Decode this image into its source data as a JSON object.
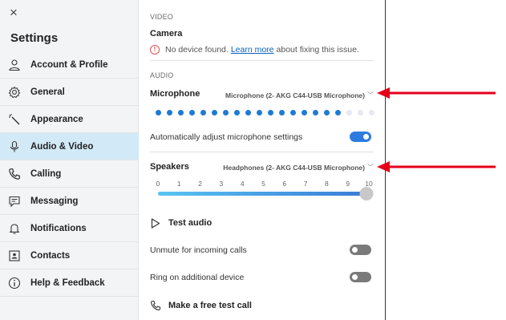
{
  "sidebar": {
    "close": "×",
    "title": "Settings",
    "items": [
      {
        "label": "Account & Profile",
        "icon": "person-icon",
        "active": false
      },
      {
        "label": "General",
        "icon": "gear-icon",
        "active": false
      },
      {
        "label": "Appearance",
        "icon": "magic-wand-icon",
        "active": false
      },
      {
        "label": "Audio & Video",
        "icon": "microphone-icon",
        "active": true
      },
      {
        "label": "Calling",
        "icon": "phone-icon",
        "active": false
      },
      {
        "label": "Messaging",
        "icon": "chat-icon",
        "active": false
      },
      {
        "label": "Notifications",
        "icon": "bell-icon",
        "active": false
      },
      {
        "label": "Contacts",
        "icon": "contact-card-icon",
        "active": false
      },
      {
        "label": "Help & Feedback",
        "icon": "info-icon",
        "active": false
      }
    ]
  },
  "video": {
    "section": "VIDEO",
    "camera_label": "Camera",
    "warning_pre": "No device found.",
    "warning_link": "Learn more",
    "warning_post": "about fixing this issue."
  },
  "audio": {
    "section": "AUDIO",
    "microphone_label": "Microphone",
    "microphone_device": "Microphone (2- AKG C44-USB Microphone)",
    "mic_level": {
      "active_dots": 17,
      "total_dots": 20
    },
    "auto_adjust_label": "Automatically adjust microphone settings",
    "auto_adjust_on": true,
    "speakers_label": "Speakers",
    "speakers_device": "Headphones (2- AKG C44-USB Microphone)",
    "volume_ticks": [
      "0",
      "1",
      "2",
      "3",
      "4",
      "5",
      "6",
      "7",
      "8",
      "9",
      "10"
    ],
    "volume_value": 10,
    "volume_max": 10,
    "test_audio_label": "Test audio",
    "unmute_label": "Unmute for incoming calls",
    "unmute_on": false,
    "ring_label": "Ring on additional device",
    "ring_on": false,
    "test_call_label": "Make a free test call"
  },
  "colors": {
    "accent": "#0a63b8",
    "toggle_on": "#2d7be0",
    "toggle_off": "#7a7a7a",
    "dot_active": "#1e7ad4",
    "dot_inactive": "#e6e9ef",
    "arrow": "#e4001b",
    "active_nav": "#d2e9f7"
  }
}
